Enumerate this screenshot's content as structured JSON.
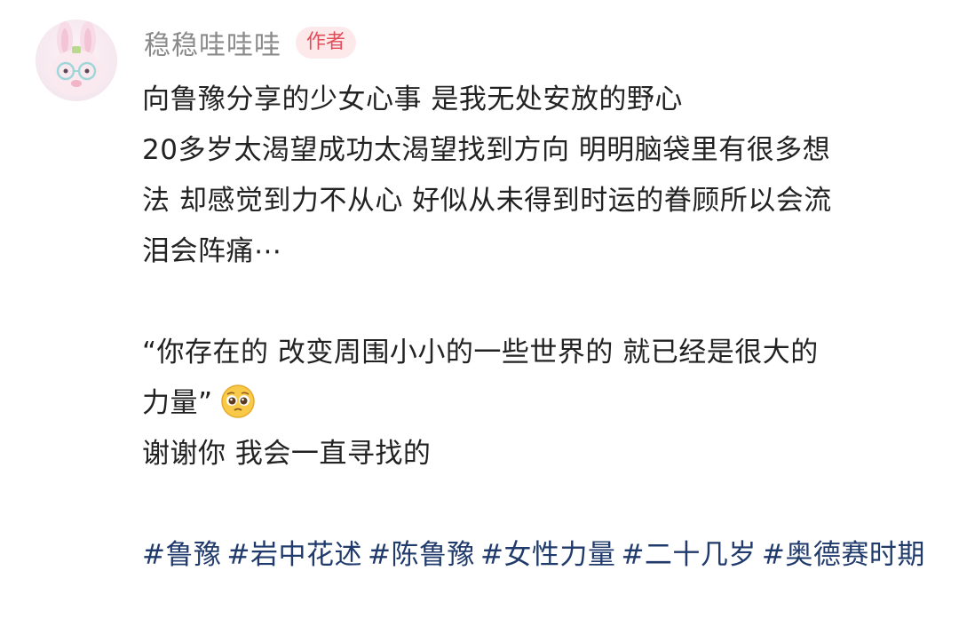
{
  "author": {
    "name": "稳稳哇哇哇",
    "badge": "作者"
  },
  "post": {
    "lines": [
      "向鲁豫分享的少女心事 是我无处安放的野心",
      "20多岁太渴望成功太渴望找到方向 明明脑袋里有很多想",
      "法 却感觉到力不从心 好似从未得到时运的眷顾所以会流",
      "泪会阵痛⋯"
    ],
    "quote_line1": "“你存在的 改变周围小小的一些世界的 就已经是很大的",
    "quote_line2": "力量”",
    "emoji": "pleading-face",
    "thanks": "谢谢你 我会一直寻找的"
  },
  "hashtags": [
    "#鲁豫",
    "#岩中花述",
    "#陈鲁豫",
    "#女性力量",
    "#二十几岁",
    "#奥德赛时期"
  ],
  "colors": {
    "hashtag": "#1f3a6b",
    "badge_text": "#e14e5b",
    "badge_bg": "#fde9ea",
    "author_name": "#8a8a8a"
  }
}
